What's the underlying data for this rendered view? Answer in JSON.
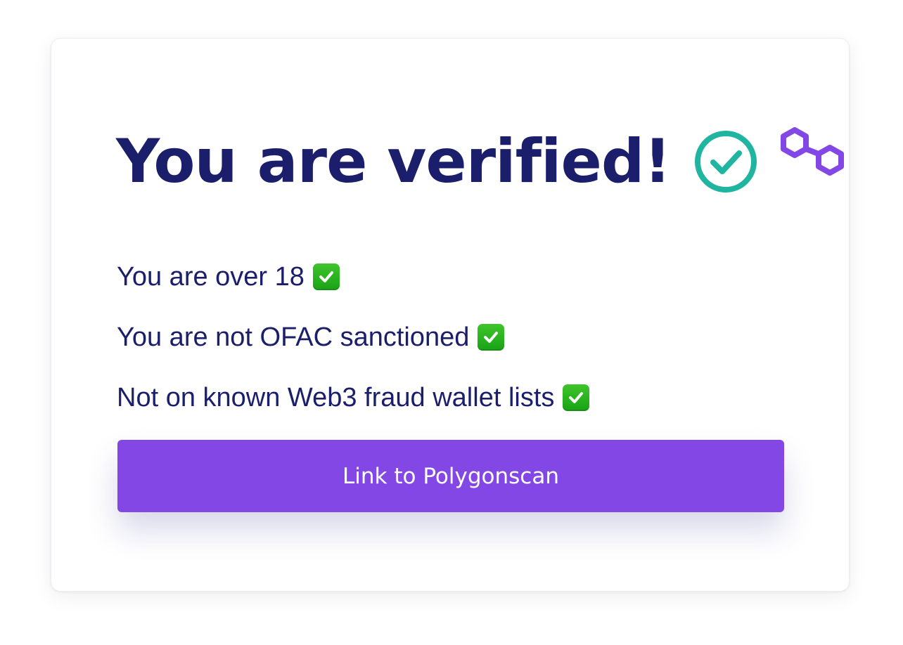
{
  "card": {
    "title": "You are verified!",
    "verified_icon": "check-circle-icon",
    "brand_icon": "polygon-logo-icon",
    "checks": [
      {
        "text": "You are over 18",
        "emoji": "✅"
      },
      {
        "text": "You are not OFAC sanctioned",
        "emoji": "✅"
      },
      {
        "text": "Not on known Web3 fraud wallet lists",
        "emoji": "✅"
      }
    ],
    "button_label": "Link to Polygonscan"
  },
  "colors": {
    "title": "#1b1f6b",
    "verified": "#1fb5a0",
    "brand": "#8347e5",
    "button": "#8347e5",
    "checkmark": "#19a316"
  }
}
